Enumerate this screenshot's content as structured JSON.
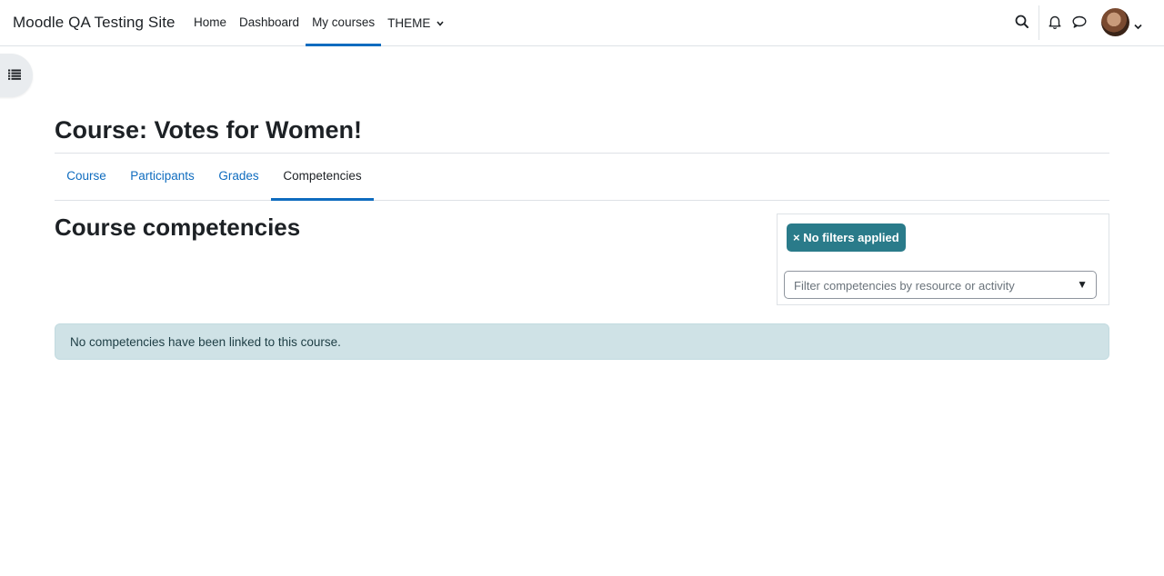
{
  "navbar": {
    "site_name": "Moodle QA Testing Site",
    "items": [
      {
        "label": "Home",
        "active": false
      },
      {
        "label": "Dashboard",
        "active": false
      },
      {
        "label": "My courses",
        "active": true
      },
      {
        "label": "THEME",
        "active": false,
        "has_dropdown": true
      }
    ],
    "icons": [
      "search-icon",
      "bell-icon",
      "message-icon"
    ],
    "user_menu": {
      "icon": "chevron-down-icon"
    }
  },
  "drawer_toggle": {
    "icon": "list-icon"
  },
  "header": {
    "title": "Course: Votes for Women!"
  },
  "secondary_nav": {
    "tabs": [
      {
        "label": "Course",
        "active": false
      },
      {
        "label": "Participants",
        "active": false
      },
      {
        "label": "Grades",
        "active": false
      },
      {
        "label": "Competencies",
        "active": true
      }
    ]
  },
  "main": {
    "section_title": "Course competencies",
    "filter": {
      "badge": "× No filters applied",
      "placeholder": "Filter competencies by resource or activity",
      "arrow": "▼"
    },
    "alert": "No competencies have been linked to this course."
  },
  "colors": {
    "accent": "#0f6cbf",
    "badge": "#2a7b8a",
    "alert_bg": "#cfe2e6"
  }
}
